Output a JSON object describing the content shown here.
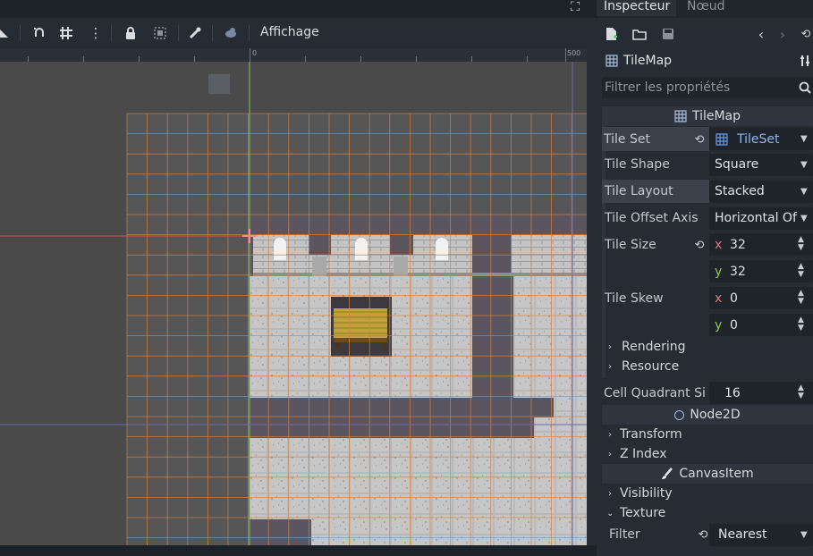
{
  "editor": {
    "toolbar": {
      "view_menu_label": "Affichage",
      "icons": [
        "select-mode-icon",
        "snap-icon",
        "grid-snap-icon",
        "more-options-icon",
        "lock-icon",
        "group-icon",
        "bone-icon",
        "skeleton-icon"
      ]
    },
    "ruler": {
      "labels": [
        "0",
        "500"
      ]
    }
  },
  "inspector": {
    "tabs": [
      {
        "label": "Inspecteur",
        "active": true
      },
      {
        "label": "Nœud",
        "active": false
      }
    ],
    "object_name": "TileMap",
    "filter_placeholder": "Filtrer les propriétés",
    "tilemap_section": "TileMap",
    "properties": {
      "tile_set": {
        "label": "Tile Set",
        "value": "TileSet"
      },
      "tile_shape": {
        "label": "Tile Shape",
        "value": "Square"
      },
      "tile_layout": {
        "label": "Tile Layout",
        "value": "Stacked"
      },
      "tile_offset_axis": {
        "label": "Tile Offset Axis",
        "value": "Horizontal Of"
      },
      "tile_size": {
        "label": "Tile Size",
        "x_axis": "x",
        "x": "32",
        "y_axis": "y",
        "y": "32"
      },
      "tile_skew": {
        "label": "Tile Skew",
        "x_axis": "x",
        "x": "0",
        "y_axis": "y",
        "y": "0"
      }
    },
    "groups_tilemap": [
      "Rendering",
      "Resource"
    ],
    "cell_quadrant": {
      "label": "Cell Quadrant Si",
      "value": "16"
    },
    "node2d_section": "Node2D",
    "groups_node2d": [
      "Transform",
      "Z Index"
    ],
    "canvasitem_section": "CanvasItem",
    "groups_canvas": [
      "Visibility",
      "Texture"
    ],
    "filter": {
      "label": "Filter",
      "value": "Nearest"
    }
  },
  "colors": {
    "accent": "#6a9ee8",
    "grid": "#d6803f",
    "axis_x": "#d94c4c",
    "axis_y": "#86c24e"
  }
}
